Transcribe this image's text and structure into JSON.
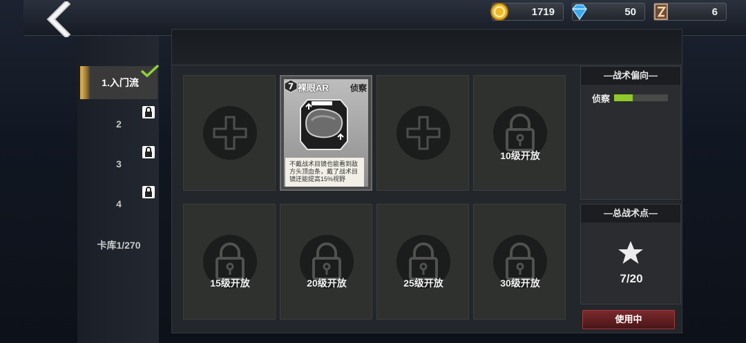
{
  "resources": {
    "gold": "1719",
    "gems": "50",
    "hero": "6"
  },
  "sidebar": {
    "tabs": [
      {
        "label": "1.入门流",
        "locked": false,
        "selected": true
      },
      {
        "label": "2",
        "locked": true
      },
      {
        "label": "3",
        "locked": true
      },
      {
        "label": "4",
        "locked": true
      }
    ],
    "deck": "卡库1/270"
  },
  "card": {
    "level": "7",
    "name": "裸眼AR",
    "type": "侦察",
    "description": "不戴战术目镜也能看到敌方头顶血条，戴了战术目镜还能提高15%视野"
  },
  "slots": {
    "unlock_10": "10级开放",
    "unlock_15": "15级开放",
    "unlock_20": "20级开放",
    "unlock_25": "25级开放",
    "unlock_30": "30级开放"
  },
  "tactic_bias": {
    "title": "—战术偏向—",
    "label": "侦察",
    "value_fraction": 0.35
  },
  "total_points": {
    "title": "—总战术点—",
    "value": "7/20"
  },
  "use_button": "使用中",
  "colors": {
    "accent_gold": "#d4a84a",
    "bias_green": "#8fc92a",
    "button_red": "#7a2a2d"
  }
}
